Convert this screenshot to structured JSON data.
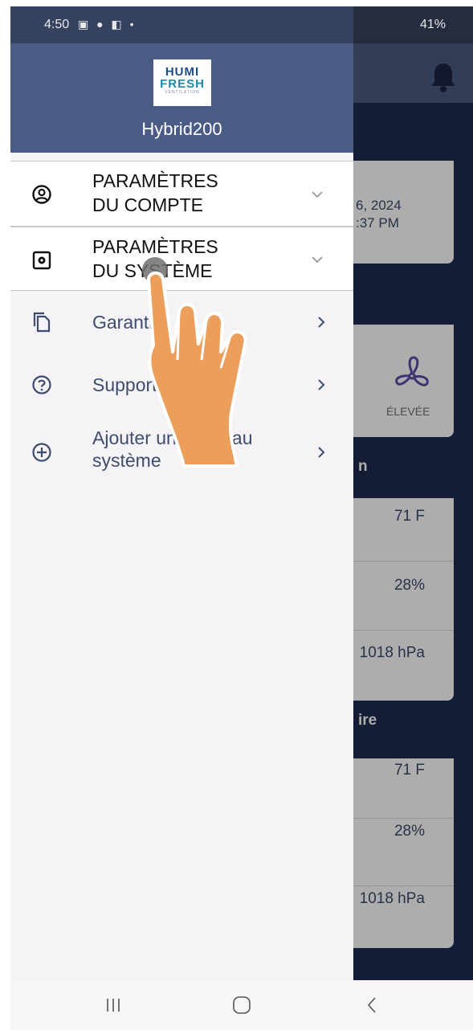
{
  "status_bar": {
    "time": "4:50",
    "notification_icons": "▣ ● ◧ •",
    "right_text": "41%"
  },
  "background": {
    "date_line1": "6, 2024",
    "date_line2": ":37 PM",
    "fan_label": "ÉLEVÉE",
    "section1_title": "n",
    "temp1": "71 F",
    "humidity1": "28%",
    "pressure1": "1018 hPa",
    "section2_title": "ire",
    "temp2": "71 F",
    "humidity2": "28%",
    "pressure2": "1018 hPa"
  },
  "drawer": {
    "logo": {
      "line1": "HUMI",
      "line2": "FRESH",
      "line3": "VENTILATION"
    },
    "app_name": "Hybrid200",
    "account_settings": {
      "line1": "PARAMÈTRES",
      "line2": "DU COMPTE",
      "icon": "account-circle-icon"
    },
    "system_settings": {
      "line1": "PARAMÈTRES",
      "line2": "DU SYSTÈME",
      "icon": "settings-box-icon"
    },
    "items": [
      {
        "label": "Garantie",
        "icon": "copy-icon"
      },
      {
        "label": "Support",
        "icon": "help-circle-icon"
      },
      {
        "label_line1": "Ajouter un nouveau",
        "label_line2": "système",
        "icon": "add-circle-icon"
      }
    ]
  },
  "colors": {
    "drawer_header": "#4a5c85",
    "label_dark": "#111111",
    "label_blue": "#3d4d70"
  }
}
